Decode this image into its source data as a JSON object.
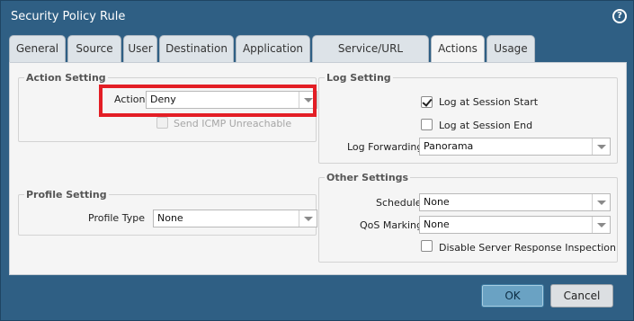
{
  "dialog": {
    "title": "Security Policy Rule",
    "help_icon_glyph": "?"
  },
  "tabs": [
    {
      "label": "General"
    },
    {
      "label": "Source"
    },
    {
      "label": "User"
    },
    {
      "label": "Destination"
    },
    {
      "label": "Application"
    },
    {
      "label": "Service/URL Category"
    },
    {
      "label": "Actions",
      "active": true
    },
    {
      "label": "Usage"
    }
  ],
  "action_setting": {
    "title": "Action Setting",
    "action_label": "Action",
    "action_value": "Deny",
    "send_icmp_label": "Send ICMP Unreachable",
    "send_icmp_checked": false
  },
  "profile_setting": {
    "title": "Profile Setting",
    "profile_type_label": "Profile Type",
    "profile_type_value": "None"
  },
  "log_setting": {
    "title": "Log Setting",
    "log_start_label": "Log at Session Start",
    "log_start_checked": true,
    "log_end_label": "Log at Session End",
    "log_end_checked": false,
    "log_forwarding_label": "Log Forwarding",
    "log_forwarding_value": "Panorama"
  },
  "other_settings": {
    "title": "Other Settings",
    "schedule_label": "Schedule",
    "schedule_value": "None",
    "qos_label": "QoS Marking",
    "qos_value": "None",
    "disable_inspection_label": "Disable Server Response Inspection",
    "disable_inspection_checked": false
  },
  "buttons": {
    "ok": "OK",
    "cancel": "Cancel"
  },
  "colors": {
    "titlebar": "#2f5f84",
    "highlight": "#e31e25",
    "ok_button": "#6aa2c3"
  }
}
